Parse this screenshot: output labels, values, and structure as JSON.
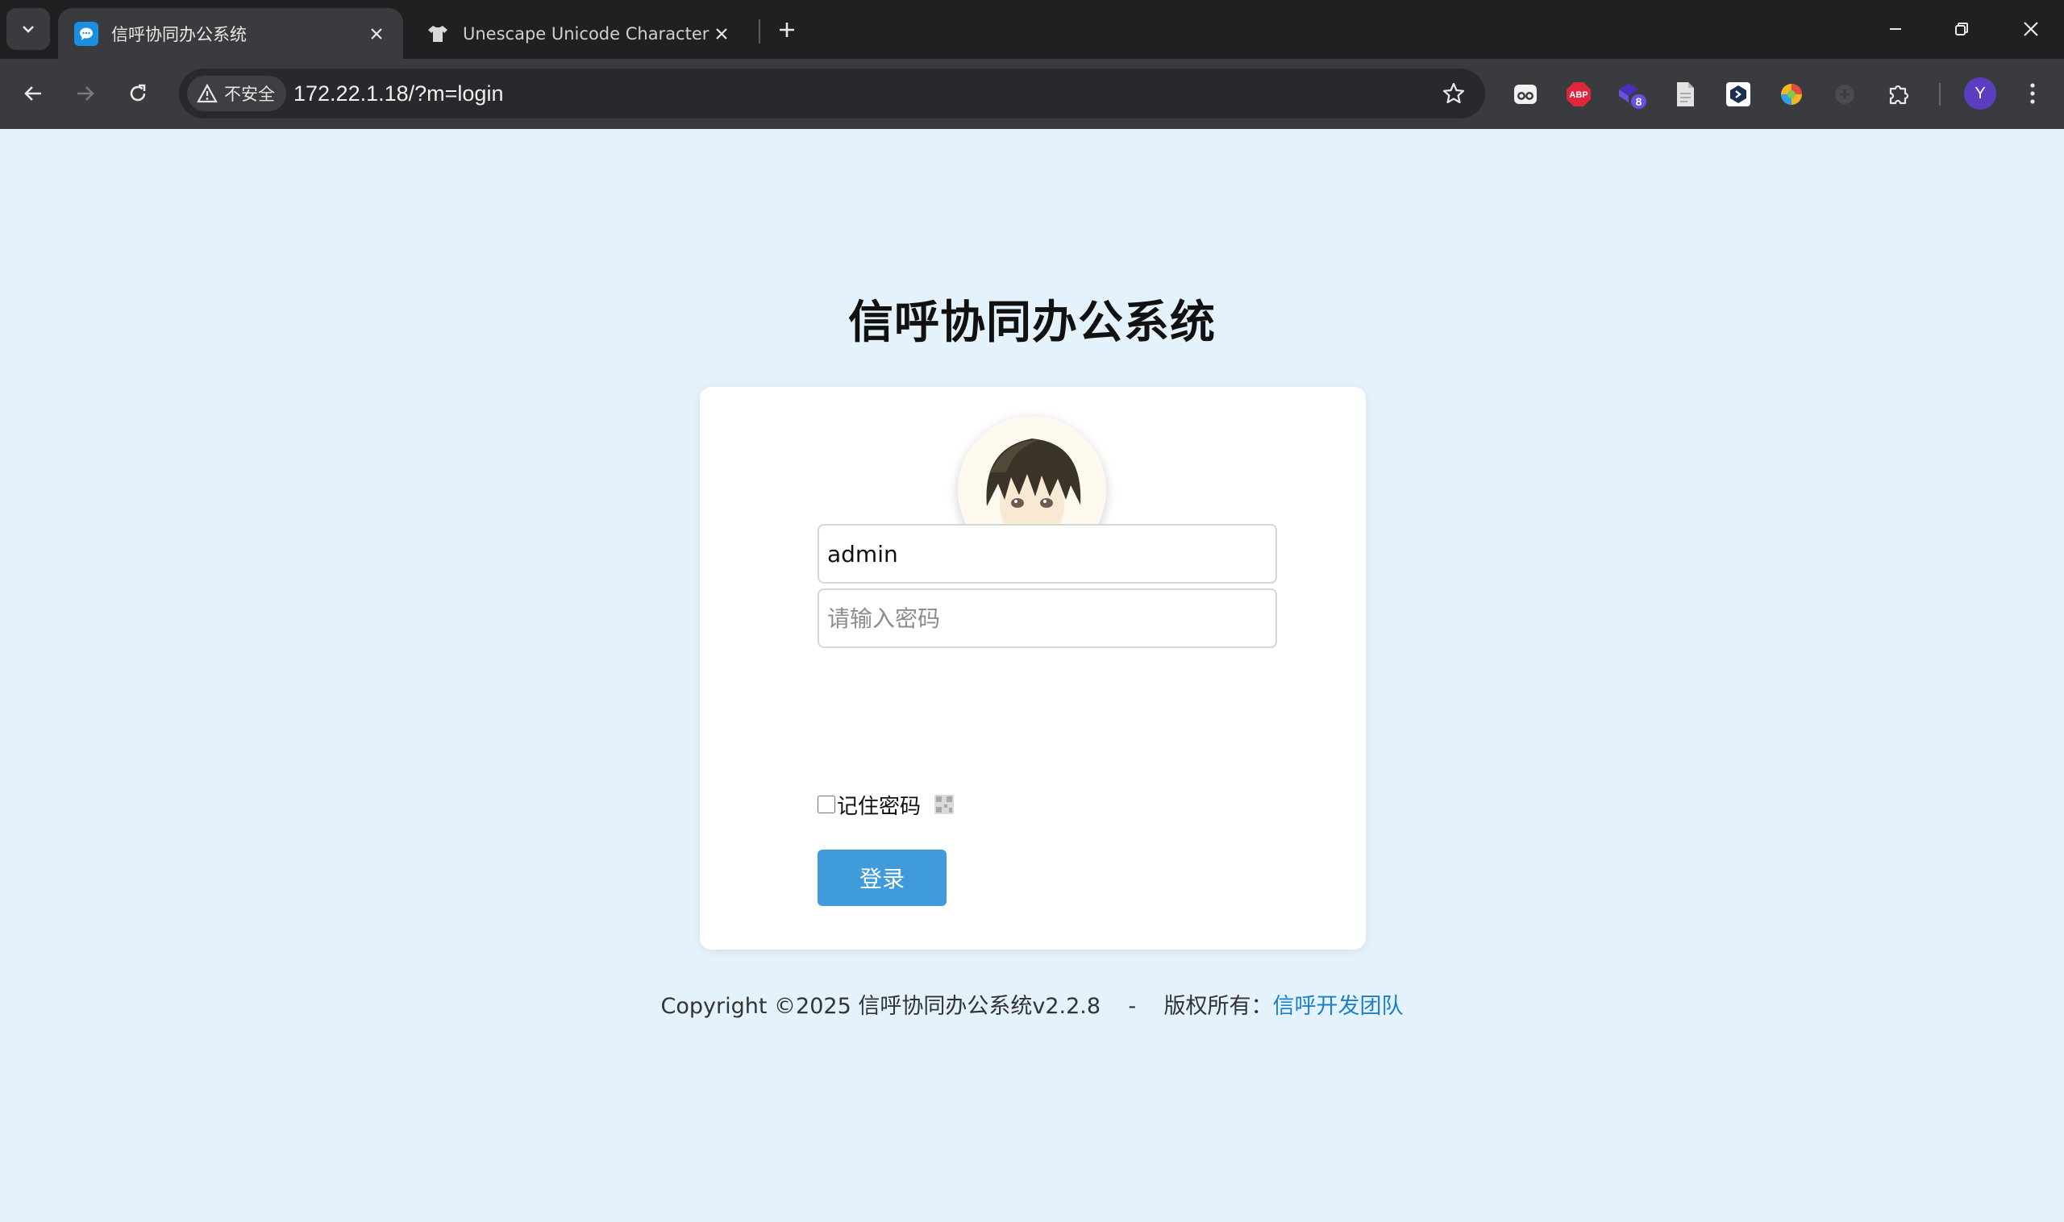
{
  "browser": {
    "tabs": [
      {
        "title": "信呼协同办公系统",
        "active": true,
        "favicon_color": "#1a8fe0"
      },
      {
        "title": "Unescape Unicode Characters -",
        "active": false
      }
    ],
    "address": {
      "security_label": "不安全",
      "url": "172.22.1.18/?m=login"
    },
    "extensions": [
      {
        "name": "ghostery-icon"
      },
      {
        "name": "adblock-plus-icon",
        "label": "ABP"
      },
      {
        "name": "extension-badge-icon",
        "badge": "8"
      },
      {
        "name": "document-icon"
      },
      {
        "name": "code-extension-icon"
      },
      {
        "name": "color-ball-icon"
      },
      {
        "name": "dim-extension-icon"
      },
      {
        "name": "puzzle-icon"
      }
    ],
    "profile_initial": "Y"
  },
  "page": {
    "title": "信呼协同办公系统",
    "username_value": "admin",
    "password_placeholder": "请输入密码",
    "remember_label": "记住密码",
    "login_label": "登录",
    "footer": {
      "copyright": "Copyright ©2025 信呼协同办公系统v2.2.8",
      "separator": "-",
      "rights": "版权所有：",
      "team_link": "信呼开发团队"
    }
  },
  "colors": {
    "page_bg": "#e4f2fb",
    "button_bg": "#3f9bd9",
    "link": "#1e7fc6"
  }
}
